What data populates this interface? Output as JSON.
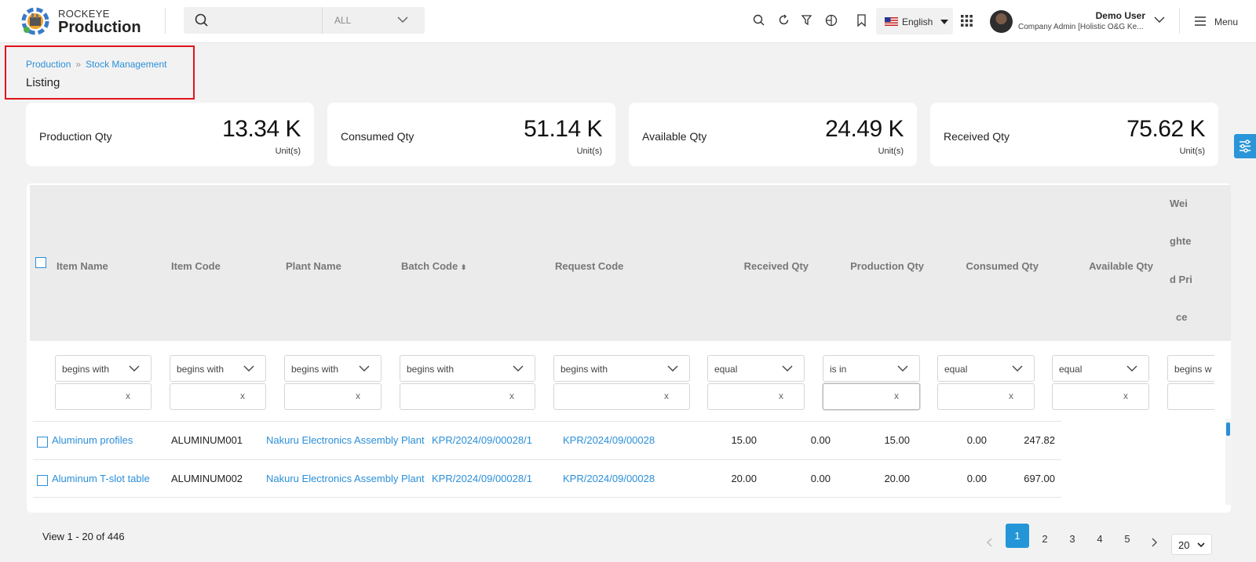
{
  "brand": {
    "top": "ROCKEYE",
    "main": "Production"
  },
  "search": {
    "scope": "ALL"
  },
  "language": {
    "label": "English"
  },
  "user": {
    "name": "Demo User",
    "role": "Company Admin [Holistic O&G Ke..."
  },
  "menu_label": "Menu",
  "breadcrumb": {
    "root": "Production",
    "current": "Stock Management",
    "title": "Listing"
  },
  "kpis": [
    {
      "label": "Production Qty",
      "value": "13.34 K",
      "unit": "Unit(s)"
    },
    {
      "label": "Consumed Qty",
      "value": "51.14 K",
      "unit": "Unit(s)"
    },
    {
      "label": "Available Qty",
      "value": "24.49 K",
      "unit": "Unit(s)"
    },
    {
      "label": "Received Qty",
      "value": "75.62 K",
      "unit": "Unit(s)"
    }
  ],
  "columns": {
    "item_name": "Item Name",
    "item_code": "Item Code",
    "plant_name": "Plant Name",
    "batch_code": "Batch Code",
    "request_code": "Request Code",
    "received_qty": "Received Qty",
    "production_qty": "Production Qty",
    "consumed_qty": "Consumed Qty",
    "available_qty": "Available Qty",
    "weighted_price_parts": [
      "Wei",
      "ghte",
      "d Pri",
      "ce"
    ]
  },
  "filters": {
    "item_name": "begins with",
    "item_code": "begins with",
    "plant_name": "begins with",
    "batch_code": "begins with",
    "request_code": "begins with",
    "received_qty": "equal",
    "production_qty": "is in",
    "consumed_qty": "equal",
    "available_qty": "equal",
    "weighted_price": "begins w",
    "clear": "x"
  },
  "rows": [
    {
      "item_name": "Aluminum profiles",
      "item_code": "ALUMINUM001",
      "plant_name": "Nakuru Electronics Assembly Plant",
      "batch_code": "KPR/2024/09/00028/1",
      "request_code": "KPR/2024/09/00028",
      "received_qty": "15.00",
      "production_qty": "0.00",
      "consumed_qty": "15.00",
      "available_qty": "0.00",
      "weighted_price": "247.82"
    },
    {
      "item_name": "Aluminum T-slot table",
      "item_code": "ALUMINUM002",
      "plant_name": "Nakuru Electronics Assembly Plant",
      "batch_code": "KPR/2024/09/00028/1",
      "request_code": "KPR/2024/09/00028",
      "received_qty": "20.00",
      "production_qty": "0.00",
      "consumed_qty": "20.00",
      "available_qty": "0.00",
      "weighted_price": "697.00"
    }
  ],
  "pagination": {
    "view_info": "View 1 - 20 of 446",
    "pages": [
      "1",
      "2",
      "3",
      "4",
      "5"
    ],
    "current_page": "1",
    "page_size": "20"
  },
  "colors": {
    "accent": "#2496d8",
    "link": "#2b8fd9",
    "highlight_box": "#e3121b"
  }
}
